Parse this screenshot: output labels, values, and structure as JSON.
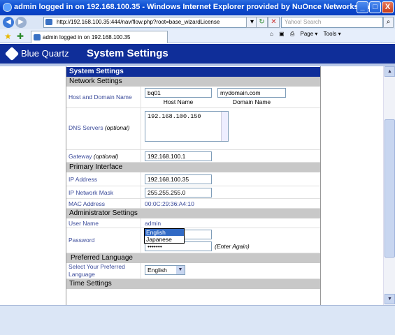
{
  "window": {
    "title": "admin logged in on 192.168.100.35 - Windows Internet Explorer provided by NuOnce Networks, Inc.",
    "minimize_label": "_",
    "maximize_label": "□",
    "close_label": "X"
  },
  "browser": {
    "url": "http://192.168.100.35:444/nav/flow.php?root=base_wizardLicense",
    "search_placeholder": "Yahoo! Search",
    "tab_title": "admin logged in on 192.168.100.35",
    "tools": [
      "Page ▾",
      "Tools ▾"
    ]
  },
  "app": {
    "brand": "Blue Quartz",
    "page_title": "System Settings"
  },
  "form": {
    "title": "System Settings",
    "network": {
      "section_title": "Network Settings",
      "host_label": "Host and Domain Name",
      "host_value": "bq01",
      "domain_value": "mydomain.com",
      "host_caption": "Host Name",
      "domain_caption": "Domain Name",
      "dns_label": "DNS Servers",
      "dns_optional": "(optional)",
      "dns_value": "192.168.100.150",
      "gateway_label": "Gateway",
      "gateway_optional": "(optional)",
      "gateway_value": "192.168.100.1"
    },
    "primary": {
      "section_title": "Primary Interface",
      "ip_label": "IP Address",
      "ip_value": "192.168.100.35",
      "mask_label": "IP Network Mask",
      "mask_value": "255.255.255.0",
      "mac_label": "MAC Address",
      "mac_value": "00:0C:29:36:A4:10"
    },
    "admin": {
      "section_title": "Administrator Settings",
      "user_label": "User Name",
      "user_value": "admin",
      "password_label": "Password",
      "password_value": "•••••••",
      "password_again_value": "•••••••",
      "again_note": "(Enter Again)"
    },
    "language": {
      "section_title": "Preferred Language",
      "select_label": "Select Your Preferred Language",
      "selected": "English",
      "options": [
        "English",
        "Japanese"
      ]
    },
    "time": {
      "section_title": "Time Settings"
    }
  }
}
